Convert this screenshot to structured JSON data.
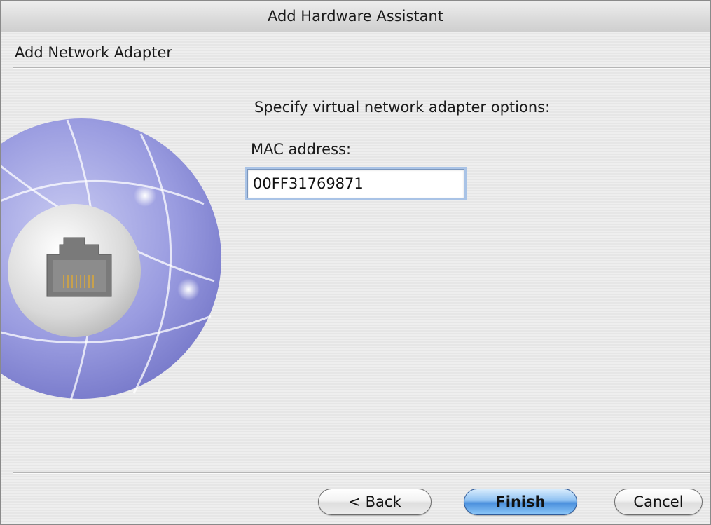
{
  "window": {
    "title": "Add Hardware Assistant"
  },
  "page": {
    "subtitle": "Add Network Adapter",
    "instruction": "Specify virtual network adapter options:"
  },
  "form": {
    "mac_label": "MAC address:",
    "mac_value": "00FF31769871"
  },
  "buttons": {
    "back_label": "< Back",
    "finish_label": "Finish",
    "cancel_label": "Cancel"
  },
  "image": {
    "icon": "network-adapter-globe-icon"
  },
  "colors": {
    "globe": "#8d8fd6",
    "finish_button": "#5b9be3",
    "input_focus": "#a9c3e6"
  }
}
